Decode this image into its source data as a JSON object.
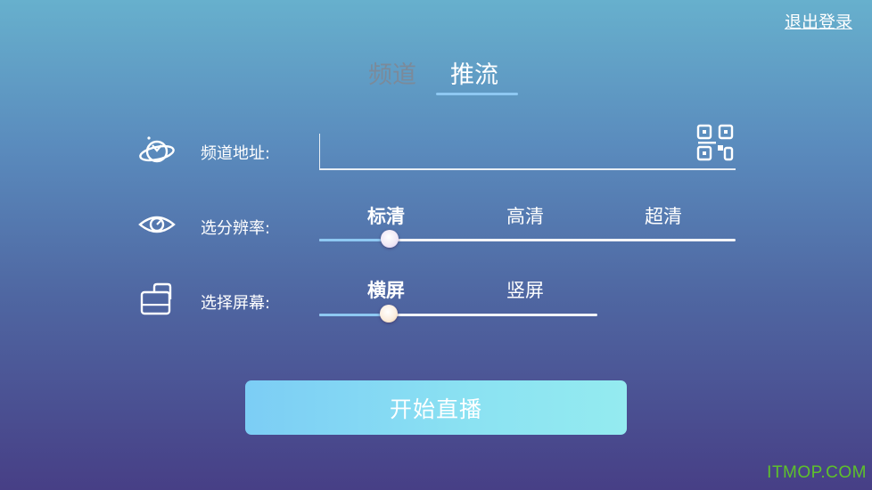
{
  "header": {
    "logout_label": "退出登录"
  },
  "tabs": [
    {
      "label": "频道",
      "active": false
    },
    {
      "label": "推流",
      "active": true
    }
  ],
  "form": {
    "address": {
      "label": "频道地址:",
      "value": "",
      "icon": "planet-icon",
      "action_icon": "qr-code-icon"
    },
    "resolution": {
      "label": "选分辨率:",
      "icon": "eye-icon",
      "options": [
        "标清",
        "高清",
        "超清"
      ],
      "selected": "标清"
    },
    "orientation": {
      "label": "选择屏幕:",
      "icon": "screen-rotate-icon",
      "options": [
        "横屏",
        "竖屏"
      ],
      "selected": "横屏"
    }
  },
  "start_button_label": "开始直播",
  "watermark": "ITMOP.COM",
  "colors": {
    "accent": "#8ec8f2",
    "button_start": "#7ccdf5",
    "button_end": "#94ebf0",
    "watermark": "#5ec22a"
  }
}
